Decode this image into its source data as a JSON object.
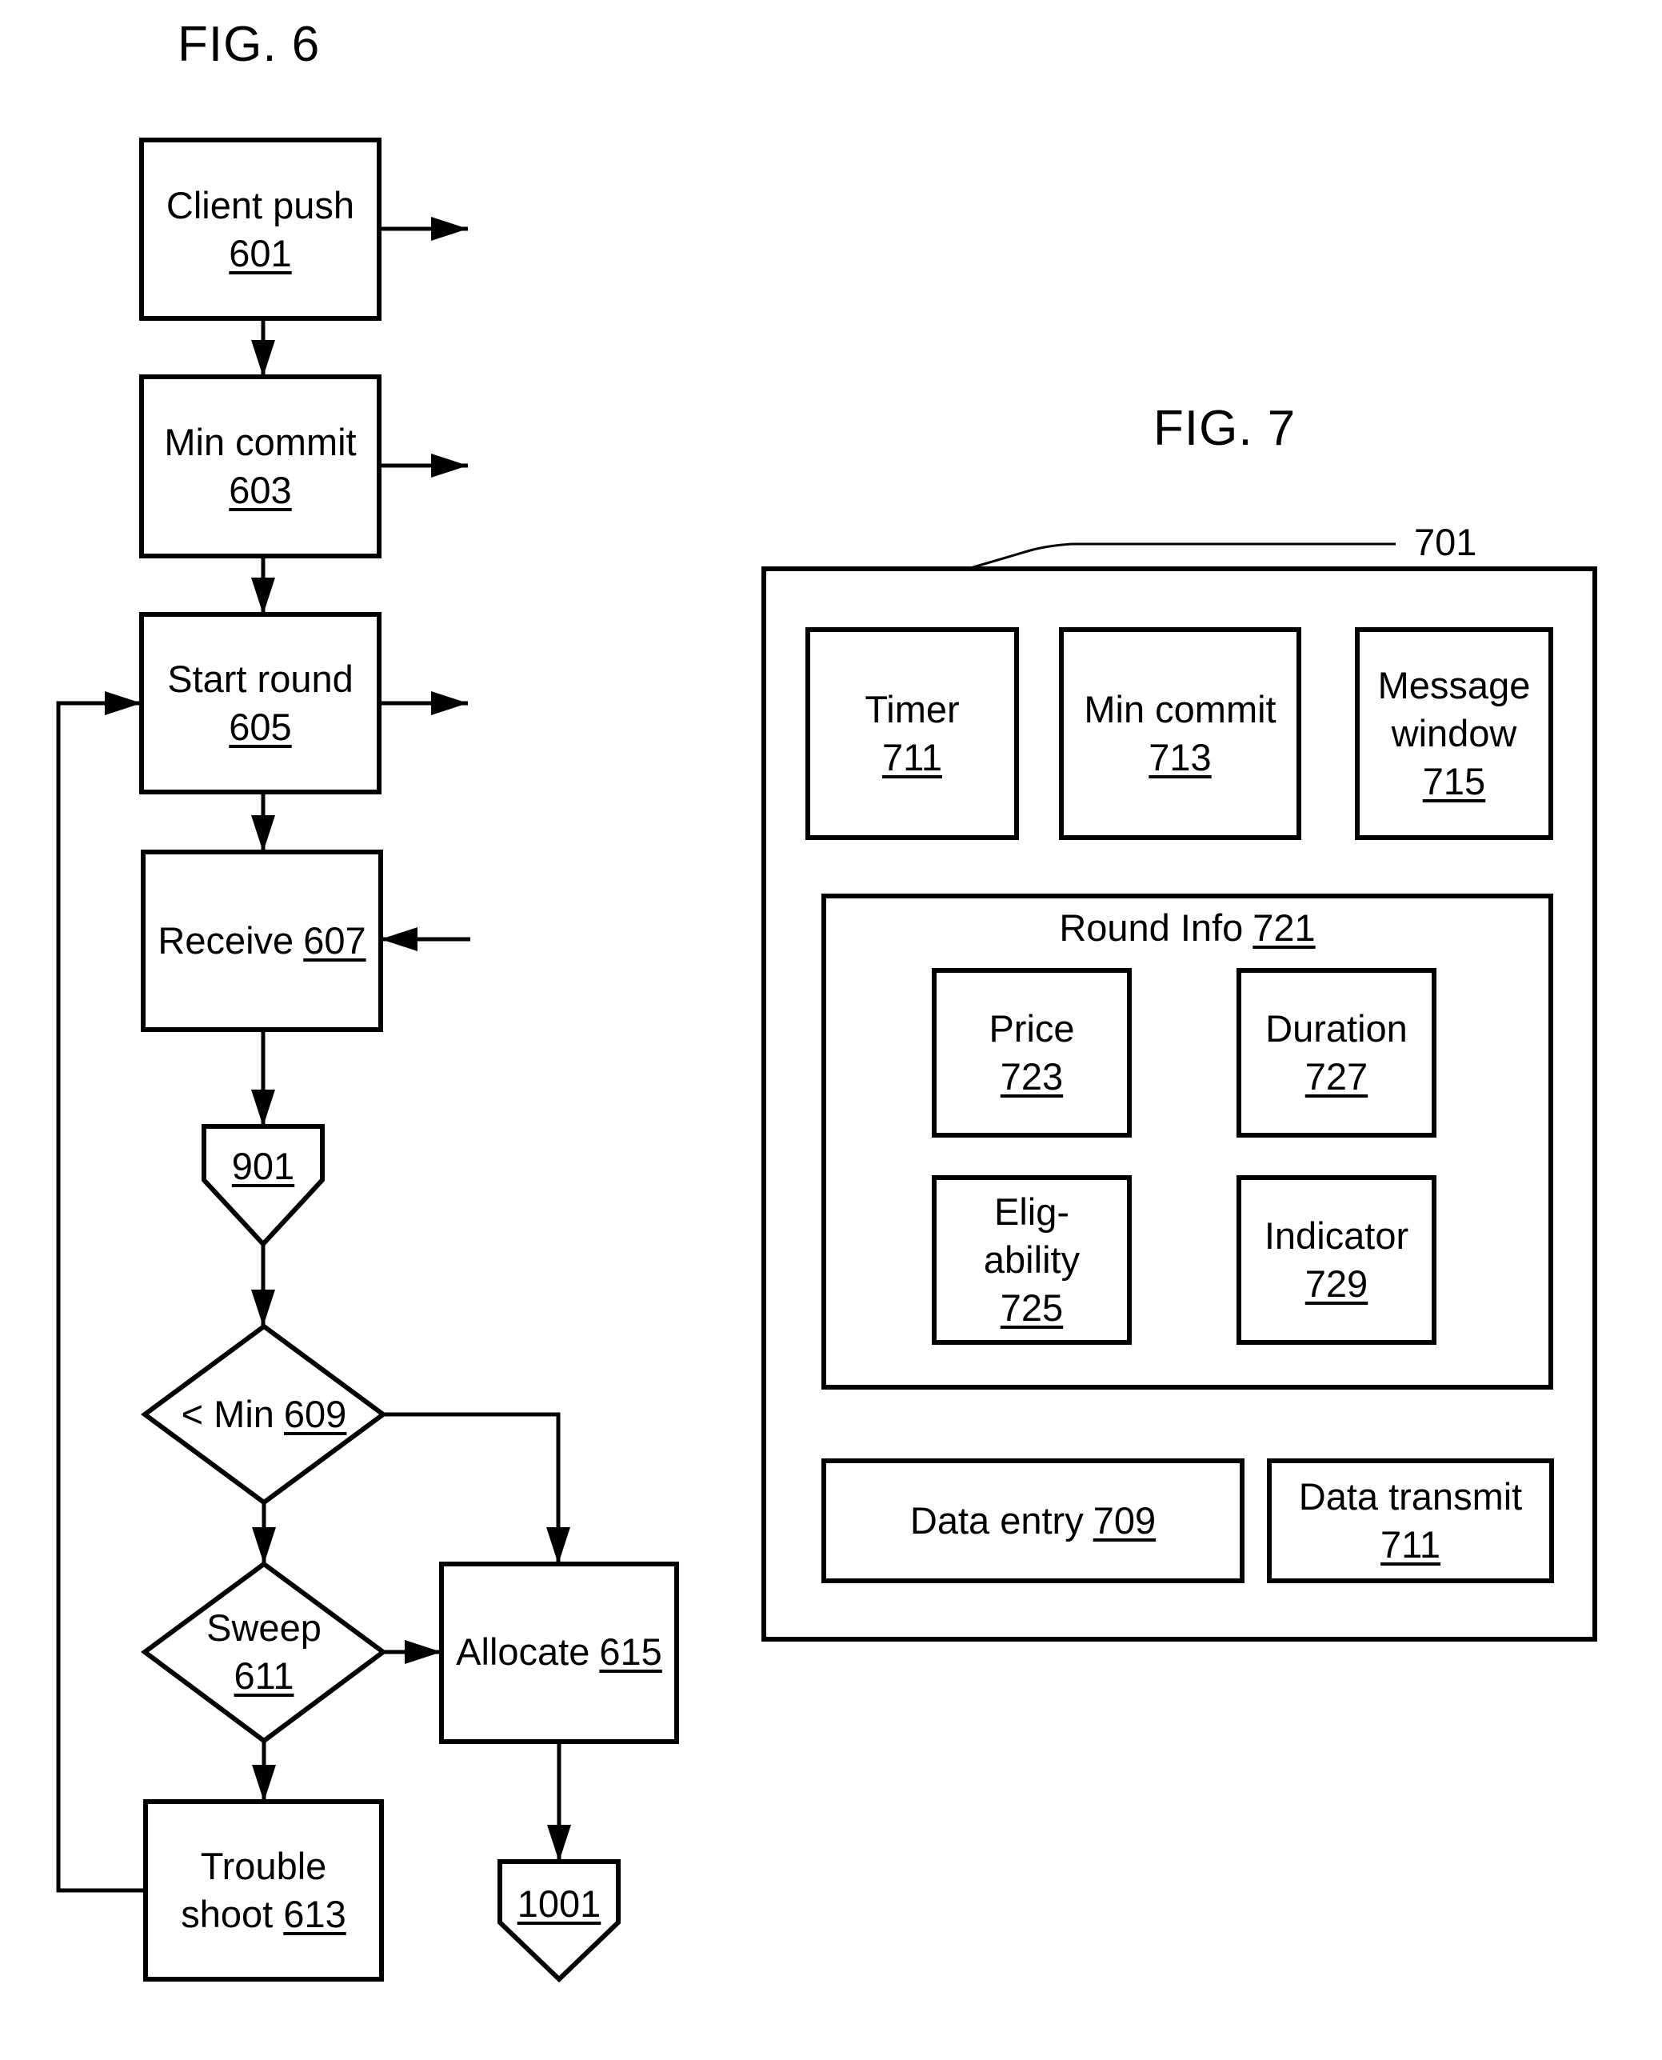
{
  "fig6": {
    "title": "FIG. 6",
    "nodes": {
      "client_push": {
        "label": "Client push",
        "ref": "601"
      },
      "min_commit": {
        "label": "Min commit",
        "ref": "603"
      },
      "start_round": {
        "label": "Start round",
        "ref": "605"
      },
      "receive": {
        "label": "Receive",
        "ref": "607"
      },
      "connector_901": {
        "label": "",
        "ref": "901"
      },
      "below_min": {
        "label": "< Min",
        "ref": "609"
      },
      "sweep": {
        "label": "Sweep",
        "ref": "611"
      },
      "trouble_shoot": {
        "label_line1": "Trouble",
        "label_line2": "shoot",
        "ref": "613"
      },
      "allocate": {
        "label": "Allocate",
        "ref": "615"
      },
      "connector_1001": {
        "label": "",
        "ref": "1001"
      }
    }
  },
  "fig7": {
    "title": "FIG. 7",
    "frame_ref": "701",
    "top_row": [
      {
        "label": "Timer",
        "ref": "711"
      },
      {
        "label": "Min commit",
        "ref": "713"
      },
      {
        "label_line1": "Message",
        "label_line2": "window",
        "ref": "715"
      }
    ],
    "round_info": {
      "label": "Round Info",
      "ref": "721",
      "items": [
        {
          "label": "Price",
          "ref": "723"
        },
        {
          "label": "Duration",
          "ref": "727"
        },
        {
          "label_line1": "Elig-",
          "label_line2": "ability",
          "ref": "725"
        },
        {
          "label": "Indicator",
          "ref": "729"
        }
      ]
    },
    "bottom_row": [
      {
        "label": "Data entry",
        "ref": "709"
      },
      {
        "label": "Data transmit",
        "ref": "711"
      }
    ]
  }
}
